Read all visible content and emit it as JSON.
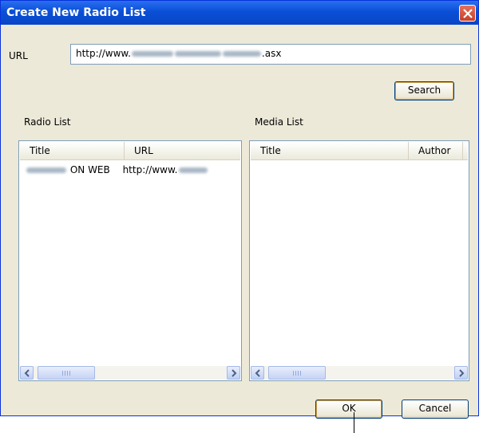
{
  "dialog": {
    "title": "Create New Radio List",
    "url_label": "URL",
    "url_value_prefix": "http://www.",
    "url_value_suffix": ".asx",
    "search_label": "Search",
    "radio_list_label": "Radio List",
    "media_list_label": "Media List",
    "ok_label": "OK",
    "cancel_label": "Cancel"
  },
  "radio_list": {
    "columns": [
      "Title",
      "URL"
    ],
    "rows": [
      {
        "title_suffix": "ON WEB",
        "url_prefix": "http://www."
      }
    ]
  },
  "media_list": {
    "columns": [
      "Title",
      "Author"
    ],
    "rows": []
  },
  "icons": {
    "close": "close-icon",
    "scroll_left": "chevron-left-icon",
    "scroll_right": "chevron-right-icon"
  }
}
